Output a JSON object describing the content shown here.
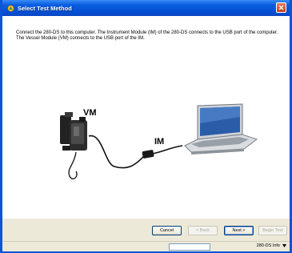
{
  "window": {
    "title": "Select Test Method",
    "accent": "#0a5ee0",
    "close_color": "#c9401b"
  },
  "content": {
    "instructions": "Connect the 280-DS to this computer. The Instrument Module (IM) of the 280-DS connects to the USB port of the computer. The Vessel Module (VM) connects to the USB port of the IM.",
    "diagram": {
      "vm_label": "VM",
      "im_label": "IM"
    }
  },
  "buttons": {
    "cancel": "Cancel",
    "back": "< Back",
    "next": "Next >",
    "begin_test": "Begin Test"
  },
  "statusbar": {
    "info_label": "280-DS Info",
    "info_icon": "chevron-down-icon"
  }
}
